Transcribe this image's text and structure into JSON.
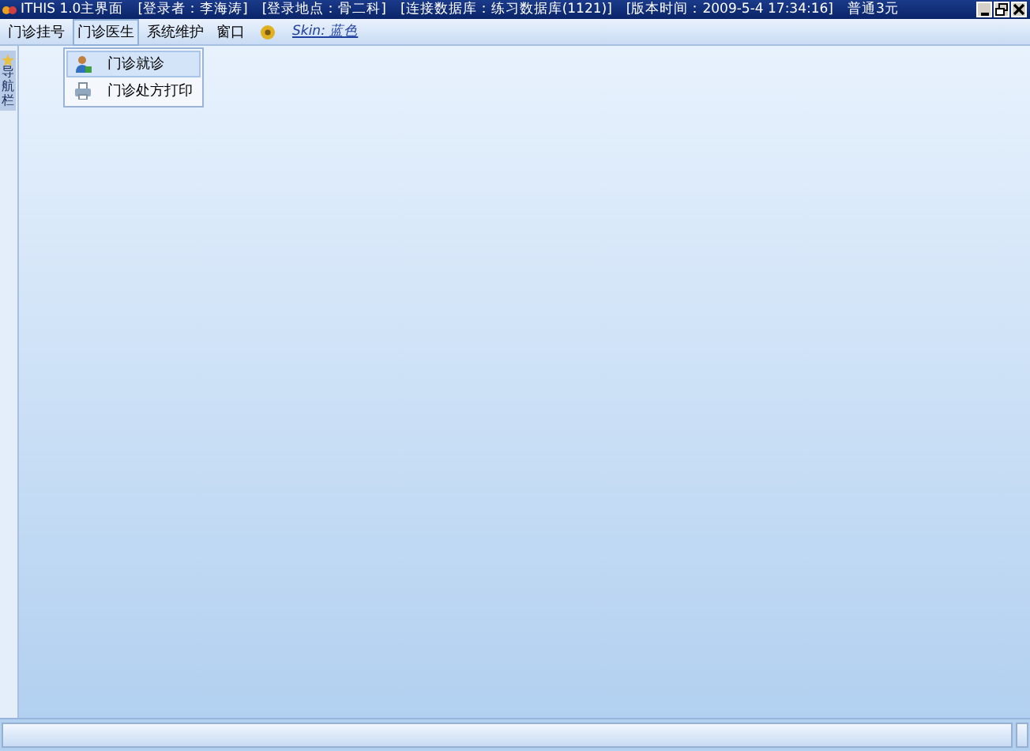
{
  "window": {
    "title_parts": [
      "ITHIS 1.0主界面",
      "[登录者：李海涛]",
      "[登录地点：骨二科]",
      "[连接数据库：练习数据库(1121)]",
      "[版本时间：2009-5-4 17:34:16]",
      "普通3元"
    ]
  },
  "menu": [
    {
      "label": "门诊挂号",
      "selected": false
    },
    {
      "label": "门诊医生",
      "selected": true
    },
    {
      "label": "系统维护",
      "selected": false
    },
    {
      "label": "窗口",
      "selected": false
    }
  ],
  "skin_link": "Skin: 蓝色",
  "dropdown": [
    {
      "label": "门诊就诊",
      "selected": true
    },
    {
      "label": "门诊处方打印",
      "selected": false
    }
  ],
  "sidebar": {
    "label": "导航栏"
  }
}
